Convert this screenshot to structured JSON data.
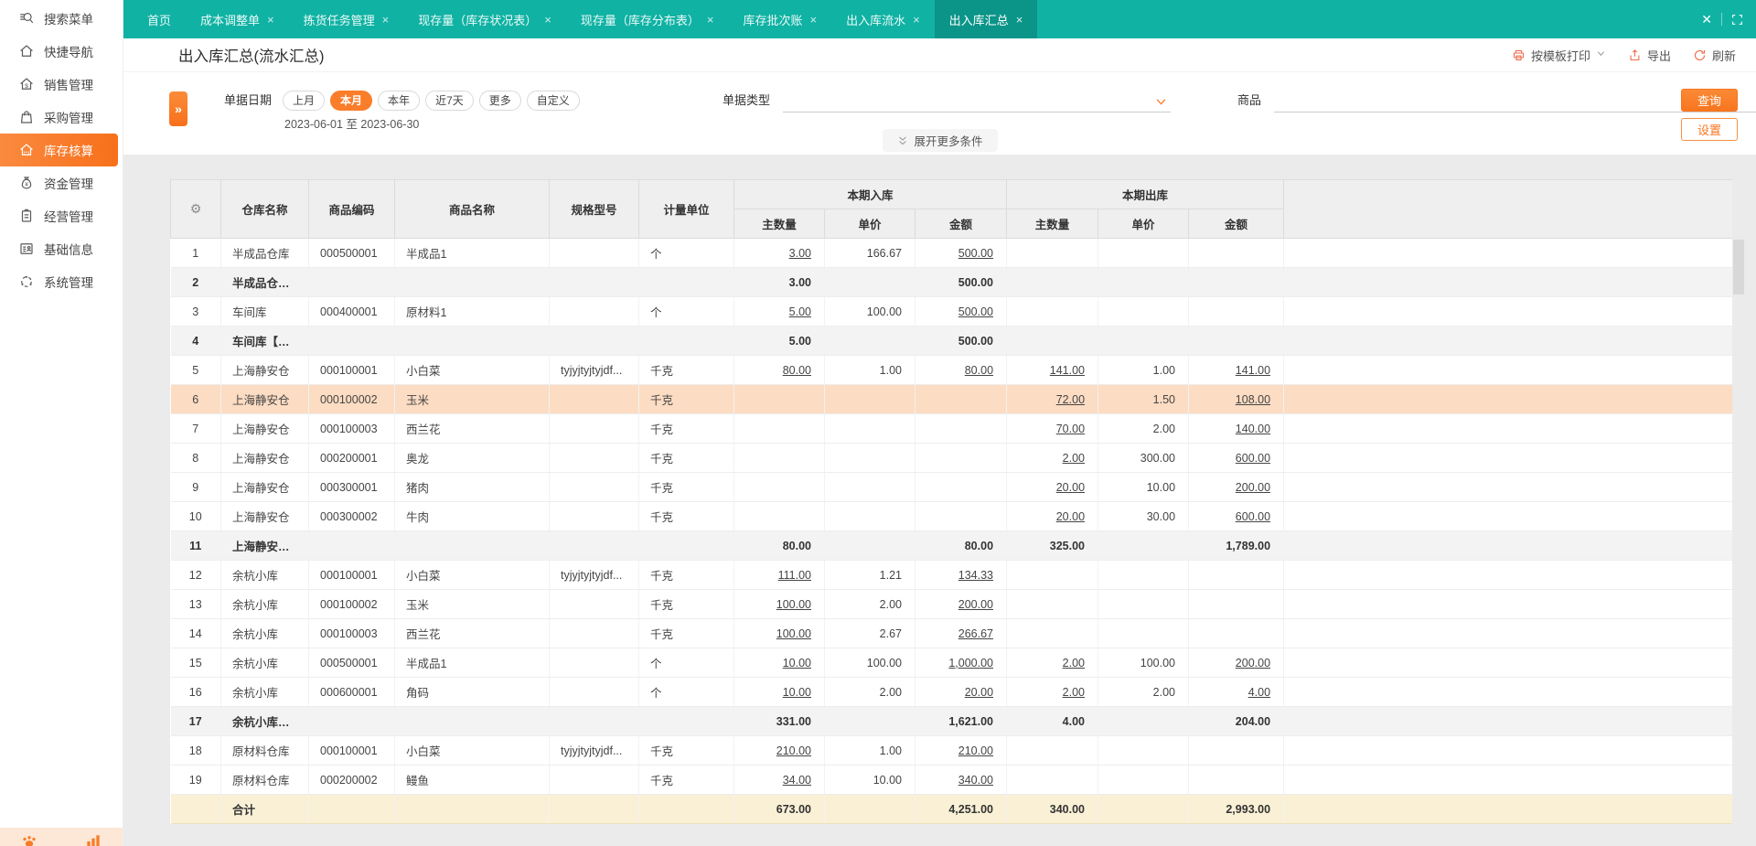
{
  "sidebar": {
    "active_index": 4,
    "items": [
      {
        "key": "search-menu",
        "icon": "search-icon",
        "label": "搜索菜单"
      },
      {
        "key": "quick-nav",
        "icon": "home-icon",
        "label": "快捷导航"
      },
      {
        "key": "sales",
        "icon": "sales-house-icon",
        "label": "销售管理"
      },
      {
        "key": "purchase",
        "icon": "shopping-bag-icon",
        "label": "采购管理"
      },
      {
        "key": "inventory-accounting",
        "icon": "warehouse-icon",
        "label": "库存核算"
      },
      {
        "key": "funds",
        "icon": "money-bag-icon",
        "label": "资金管理"
      },
      {
        "key": "operations",
        "icon": "clipboard-icon",
        "label": "经营管理"
      },
      {
        "key": "base-info",
        "icon": "id-card-icon",
        "label": "基础信息"
      },
      {
        "key": "system",
        "icon": "system-icon",
        "label": "系统管理"
      }
    ]
  },
  "tabbar": {
    "tabs": [
      {
        "key": "home",
        "label": "首页",
        "closable": false,
        "active": false
      },
      {
        "key": "cost-adjustment",
        "label": "成本调整单",
        "closable": true,
        "active": false
      },
      {
        "key": "picking-task",
        "label": "拣货任务管理",
        "closable": true,
        "active": false
      },
      {
        "key": "stock-status",
        "label": "现存量（库存状况表）",
        "closable": true,
        "active": false
      },
      {
        "key": "stock-distribution",
        "label": "现存量（库存分布表）",
        "closable": true,
        "active": false
      },
      {
        "key": "inventory-batch",
        "label": "库存批次账",
        "closable": true,
        "active": false
      },
      {
        "key": "inout-flow",
        "label": "出入库流水",
        "closable": true,
        "active": false
      },
      {
        "key": "inout-summary",
        "label": "出入库汇总",
        "closable": true,
        "active": true
      }
    ]
  },
  "titlebar": {
    "title": "出入库汇总(流水汇总)",
    "print_label": "按模板打印",
    "export_label": "导出",
    "refresh_label": "刷新"
  },
  "filters": {
    "collapse_icon": "»",
    "date_label": "单据日期",
    "date_pills": [
      "上月",
      "本月",
      "本年",
      "近7天",
      "更多",
      "自定义"
    ],
    "date_active_pill": "本月",
    "date_range": "2023-06-01 至 2023-06-30",
    "doc_type_label": "单据类型",
    "product_label": "商品",
    "product_more": "...",
    "search_button": "查询",
    "settings_button": "设置",
    "expand_more": "展开更多条件"
  },
  "table": {
    "col_headers": {
      "warehouse": "仓库名称",
      "code": "商品编码",
      "name": "商品名称",
      "spec": "规格型号",
      "unit": "计量单位",
      "in_group": "本期入库",
      "out_group": "本期出库",
      "qty": "主数量",
      "price": "单价",
      "amount": "金额"
    },
    "rows": [
      {
        "type": "data",
        "num": "1",
        "warehouse": "半成品仓库",
        "code": "000500001",
        "name": "半成品1",
        "spec": "",
        "unit": "个",
        "in_qty": "3.00",
        "in_price": "166.67",
        "in_amt": "500.00",
        "out_qty": "",
        "out_price": "",
        "out_amt": ""
      },
      {
        "type": "subtotal",
        "num": "2",
        "warehouse": "半成品仓库...",
        "code": "",
        "name": "",
        "spec": "",
        "unit": "",
        "in_qty": "3.00",
        "in_price": "",
        "in_amt": "500.00",
        "out_qty": "",
        "out_price": "",
        "out_amt": ""
      },
      {
        "type": "data",
        "num": "3",
        "warehouse": "车间库",
        "code": "000400001",
        "name": "原材料1",
        "spec": "",
        "unit": "个",
        "in_qty": "5.00",
        "in_price": "100.00",
        "in_amt": "500.00",
        "out_qty": "",
        "out_price": "",
        "out_amt": ""
      },
      {
        "type": "subtotal",
        "num": "4",
        "warehouse": "车间库【小...",
        "code": "",
        "name": "",
        "spec": "",
        "unit": "",
        "in_qty": "5.00",
        "in_price": "",
        "in_amt": "500.00",
        "out_qty": "",
        "out_price": "",
        "out_amt": ""
      },
      {
        "type": "data",
        "num": "5",
        "warehouse": "上海静安仓",
        "code": "000100001",
        "name": "小白菜",
        "spec": "tyjyjtyjtyjdf...",
        "unit": "千克",
        "in_qty": "80.00",
        "in_price": "1.00",
        "in_amt": "80.00",
        "out_qty": "141.00",
        "out_price": "1.00",
        "out_amt": "141.00"
      },
      {
        "type": "data",
        "selected": true,
        "num": "6",
        "warehouse": "上海静安仓",
        "code": "000100002",
        "name": "玉米",
        "spec": "",
        "unit": "千克",
        "in_qty": "",
        "in_price": "",
        "in_amt": "",
        "out_qty": "72.00",
        "out_price": "1.50",
        "out_amt": "108.00"
      },
      {
        "type": "data",
        "num": "7",
        "warehouse": "上海静安仓",
        "code": "000100003",
        "name": "西兰花",
        "spec": "",
        "unit": "千克",
        "in_qty": "",
        "in_price": "",
        "in_amt": "",
        "out_qty": "70.00",
        "out_price": "2.00",
        "out_amt": "140.00"
      },
      {
        "type": "data",
        "num": "8",
        "warehouse": "上海静安仓",
        "code": "000200001",
        "name": "奥龙",
        "spec": "",
        "unit": "千克",
        "in_qty": "",
        "in_price": "",
        "in_amt": "",
        "out_qty": "2.00",
        "out_price": "300.00",
        "out_amt": "600.00"
      },
      {
        "type": "data",
        "num": "9",
        "warehouse": "上海静安仓",
        "code": "000300001",
        "name": "猪肉",
        "spec": "",
        "unit": "千克",
        "in_qty": "",
        "in_price": "",
        "in_amt": "",
        "out_qty": "20.00",
        "out_price": "10.00",
        "out_amt": "200.00"
      },
      {
        "type": "data",
        "num": "10",
        "warehouse": "上海静安仓",
        "code": "000300002",
        "name": "牛肉",
        "spec": "",
        "unit": "千克",
        "in_qty": "",
        "in_price": "",
        "in_amt": "",
        "out_qty": "20.00",
        "out_price": "30.00",
        "out_amt": "600.00"
      },
      {
        "type": "subtotal",
        "num": "11",
        "warehouse": "上海静安仓...",
        "code": "",
        "name": "",
        "spec": "",
        "unit": "",
        "in_qty": "80.00",
        "in_price": "",
        "in_amt": "80.00",
        "out_qty": "325.00",
        "out_price": "",
        "out_amt": "1,789.00"
      },
      {
        "type": "data",
        "num": "12",
        "warehouse": "余杭小库",
        "code": "000100001",
        "name": "小白菜",
        "spec": "tyjyjtyjtyjdf...",
        "unit": "千克",
        "in_qty": "111.00",
        "in_price": "1.21",
        "in_amt": "134.33",
        "out_qty": "",
        "out_price": "",
        "out_amt": ""
      },
      {
        "type": "data",
        "num": "13",
        "warehouse": "余杭小库",
        "code": "000100002",
        "name": "玉米",
        "spec": "",
        "unit": "千克",
        "in_qty": "100.00",
        "in_price": "2.00",
        "in_amt": "200.00",
        "out_qty": "",
        "out_price": "",
        "out_amt": ""
      },
      {
        "type": "data",
        "num": "14",
        "warehouse": "余杭小库",
        "code": "000100003",
        "name": "西兰花",
        "spec": "",
        "unit": "千克",
        "in_qty": "100.00",
        "in_price": "2.67",
        "in_amt": "266.67",
        "out_qty": "",
        "out_price": "",
        "out_amt": ""
      },
      {
        "type": "data",
        "num": "15",
        "warehouse": "余杭小库",
        "code": "000500001",
        "name": "半成品1",
        "spec": "",
        "unit": "个",
        "in_qty": "10.00",
        "in_price": "100.00",
        "in_amt": "1,000.00",
        "out_qty": "2.00",
        "out_price": "100.00",
        "out_amt": "200.00"
      },
      {
        "type": "data",
        "num": "16",
        "warehouse": "余杭小库",
        "code": "000600001",
        "name": "角码",
        "spec": "",
        "unit": "个",
        "in_qty": "10.00",
        "in_price": "2.00",
        "in_amt": "20.00",
        "out_qty": "2.00",
        "out_price": "2.00",
        "out_amt": "4.00"
      },
      {
        "type": "subtotal",
        "num": "17",
        "warehouse": "余杭小库【...",
        "code": "",
        "name": "",
        "spec": "",
        "unit": "",
        "in_qty": "331.00",
        "in_price": "",
        "in_amt": "1,621.00",
        "out_qty": "4.00",
        "out_price": "",
        "out_amt": "204.00"
      },
      {
        "type": "data",
        "num": "18",
        "warehouse": "原材料仓库",
        "code": "000100001",
        "name": "小白菜",
        "spec": "tyjyjtyjtyjdf...",
        "unit": "千克",
        "in_qty": "210.00",
        "in_price": "1.00",
        "in_amt": "210.00",
        "out_qty": "",
        "out_price": "",
        "out_amt": ""
      },
      {
        "type": "data",
        "num": "19",
        "warehouse": "原材料仓库",
        "code": "000200002",
        "name": "鳗鱼",
        "spec": "",
        "unit": "千克",
        "in_qty": "34.00",
        "in_price": "10.00",
        "in_amt": "340.00",
        "out_qty": "",
        "out_price": "",
        "out_amt": ""
      },
      {
        "type": "total",
        "num": "",
        "warehouse": "合计",
        "code": "",
        "name": "",
        "spec": "",
        "unit": "",
        "in_qty": "673.00",
        "in_price": "",
        "in_amt": "4,251.00",
        "out_qty": "340.00",
        "out_price": "",
        "out_amt": "2,993.00"
      }
    ]
  },
  "colors": {
    "accent_orange": "#f97c28",
    "tabbar_teal": "#10b2a4",
    "active_tab_teal": "#0b9488",
    "selected_row_bg": "#fcdcc2",
    "subtotal_row_bg": "#f3f3f3",
    "total_row_bg": "#faf0d6"
  }
}
